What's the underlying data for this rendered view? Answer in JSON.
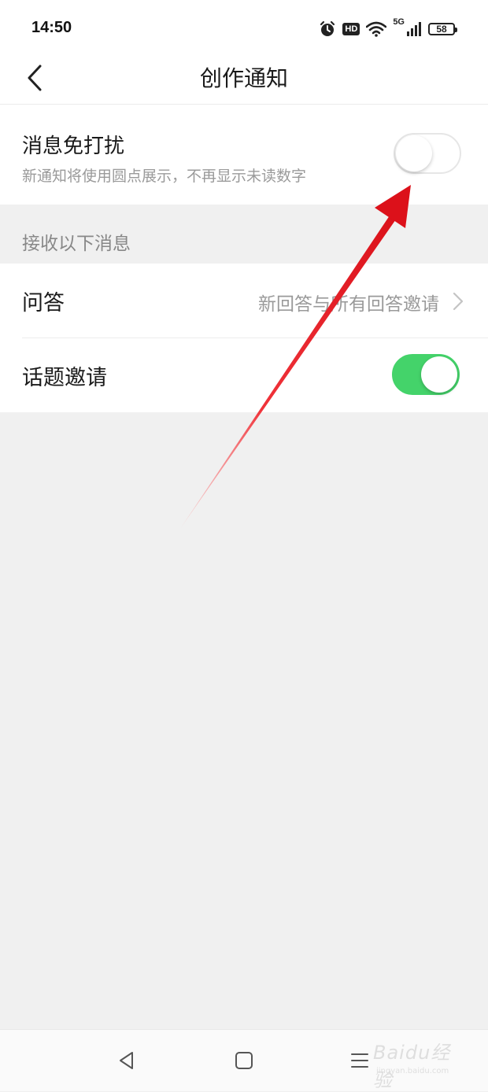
{
  "status_bar": {
    "time": "14:50",
    "hd": "HD",
    "network": "5G",
    "battery": "58"
  },
  "header": {
    "title": "创作通知"
  },
  "dnd": {
    "title": "消息免打扰",
    "description": "新通知将使用圆点展示，不再显示未读数字",
    "enabled": false
  },
  "section": {
    "label": "接收以下消息"
  },
  "list": [
    {
      "label": "问答",
      "value": "新回答与所有回答邀请",
      "type": "link"
    },
    {
      "label": "话题邀请",
      "type": "toggle",
      "enabled": true
    }
  ],
  "watermark": {
    "main": "Baidu经验",
    "sub": "jingyan.baidu.com"
  },
  "colors": {
    "toggle_on": "#44d36a",
    "annotation_arrow": "#e8141e",
    "background": "#f0f0f0"
  },
  "icons": [
    "alarm-icon",
    "wifi-icon",
    "signal-icon",
    "battery-icon",
    "back-arrow-icon",
    "chevron-right-icon",
    "nav-back-icon",
    "nav-home-icon",
    "nav-menu-icon"
  ]
}
